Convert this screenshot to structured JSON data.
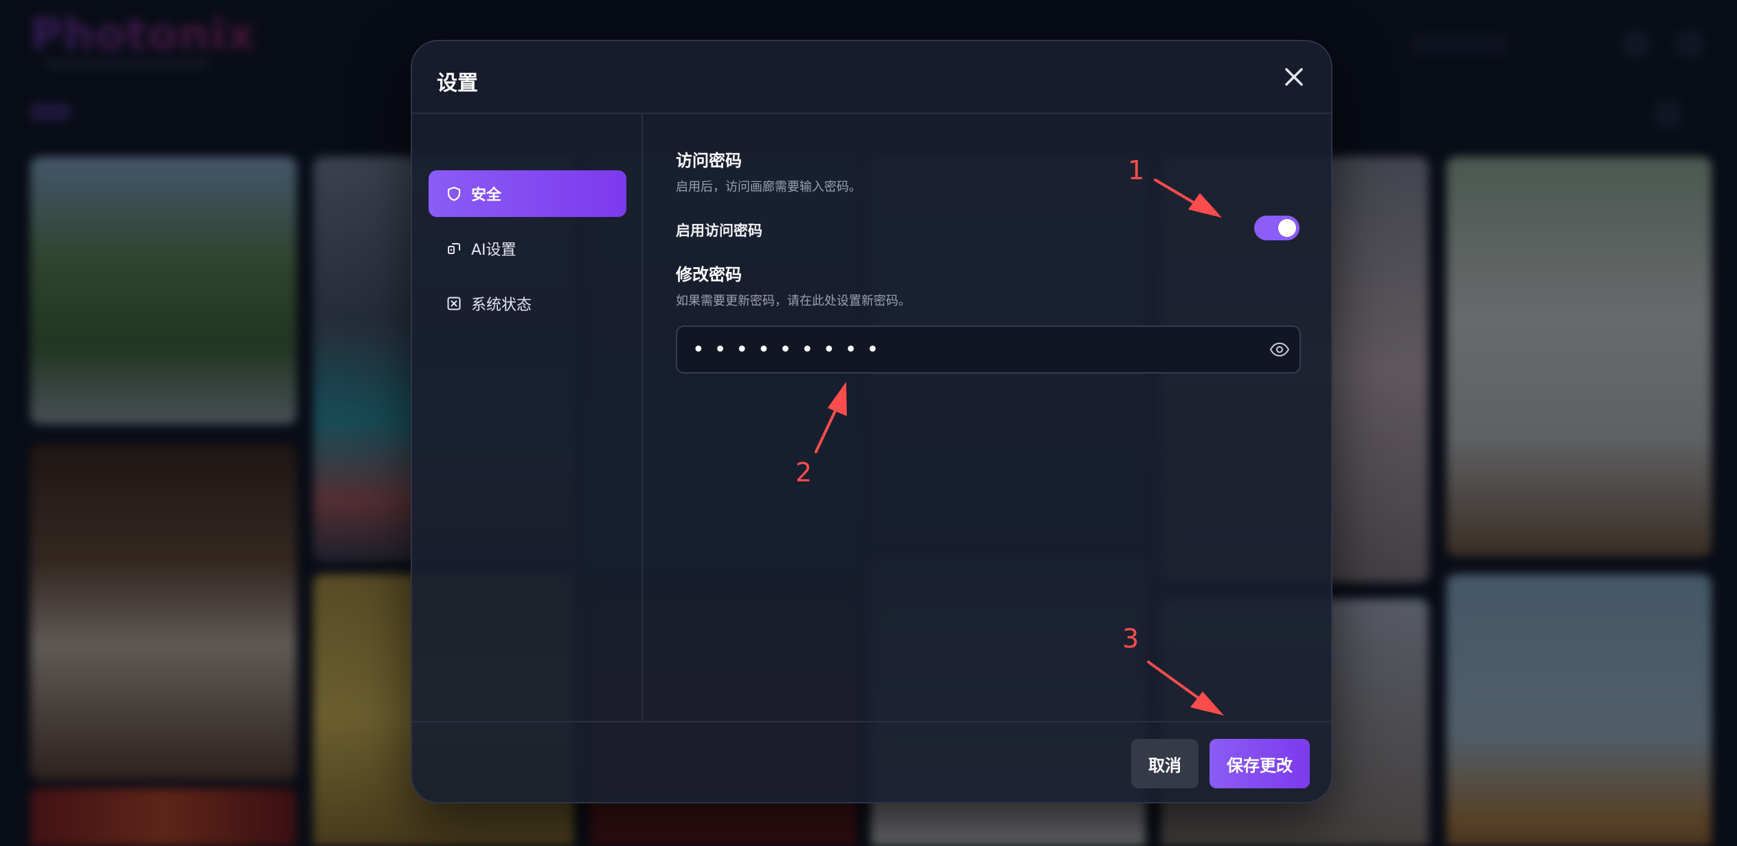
{
  "modal": {
    "title": "设置",
    "close_icon": "close-icon"
  },
  "sidebar": {
    "items": [
      {
        "label": "安全",
        "icon": "shield-icon",
        "active": true
      },
      {
        "label": "AI设置",
        "icon": "ai-chip-icon",
        "active": false
      },
      {
        "label": "系统状态",
        "icon": "status-box-icon",
        "active": false
      }
    ]
  },
  "security": {
    "access_title": "访问密码",
    "access_desc": "启用后，访问画廊需要输入密码。",
    "toggle_label": "启用访问密码",
    "toggle_on": true,
    "change_title": "修改密码",
    "change_desc": "如果需要更新密码，请在此处设置新密码。",
    "password_masked": "•••••••••",
    "password_icon": "eye-icon"
  },
  "footer": {
    "cancel_label": "取消",
    "save_label": "保存更改"
  },
  "annotations": [
    "1",
    "2",
    "3"
  ],
  "colors": {
    "accent": "#8b5cf6",
    "annotation": "#ff4d4d",
    "background": "#0b0f19"
  }
}
